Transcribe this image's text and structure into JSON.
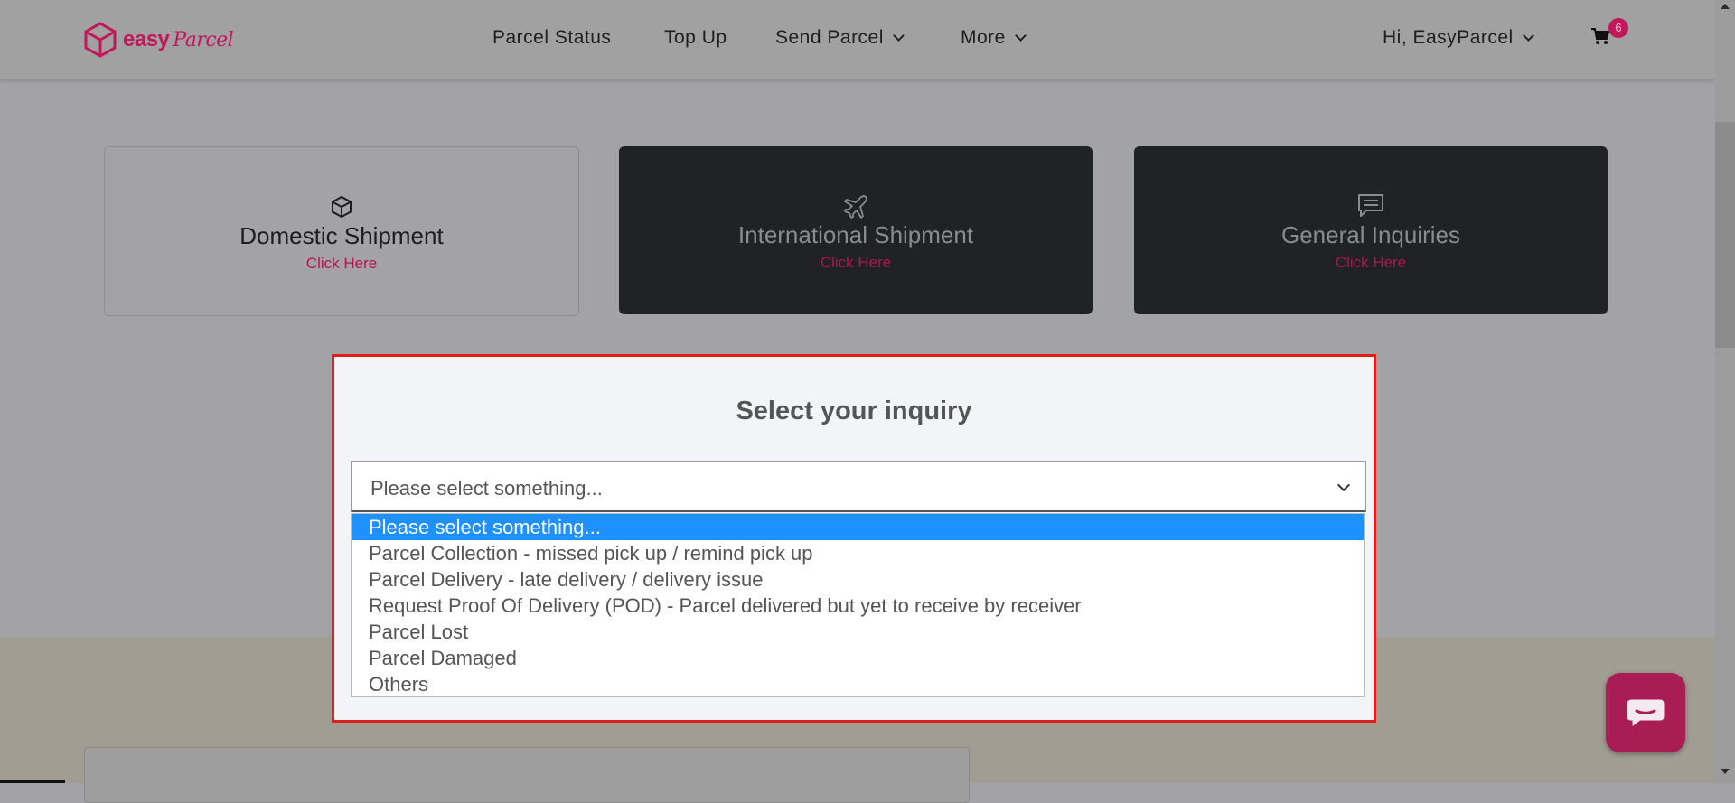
{
  "header": {
    "logo_text": "easy",
    "logo_script": "Parcel",
    "nav": {
      "parcel_status": "Parcel Status",
      "top_up": "Top Up",
      "send_parcel": "Send Parcel",
      "more": "More",
      "greeting": "Hi, EasyParcel"
    },
    "cart_count": "6"
  },
  "cards": [
    {
      "title": "Domestic Shipment",
      "link": "Click Here",
      "icon": "box-icon"
    },
    {
      "title": "International Shipment",
      "link": "Click Here",
      "icon": "airplane-icon"
    },
    {
      "title": "General Inquiries",
      "link": "Click Here",
      "icon": "message-icon"
    }
  ],
  "inquiry": {
    "title": "Select your inquiry",
    "selected_value": "Please select something...",
    "options": [
      "Please select something...",
      "Parcel Collection - missed pick up / remind pick up",
      "Parcel Delivery - late delivery / delivery issue",
      "Request Proof Of Delivery (POD) - Parcel delivered but yet to receive by receiver",
      "Parcel Lost",
      "Parcel Damaged",
      "Others"
    ]
  },
  "colors": {
    "brand": "#c2185b",
    "highlight_border": "#e01f1f",
    "selected_option": "#1e90ff"
  }
}
